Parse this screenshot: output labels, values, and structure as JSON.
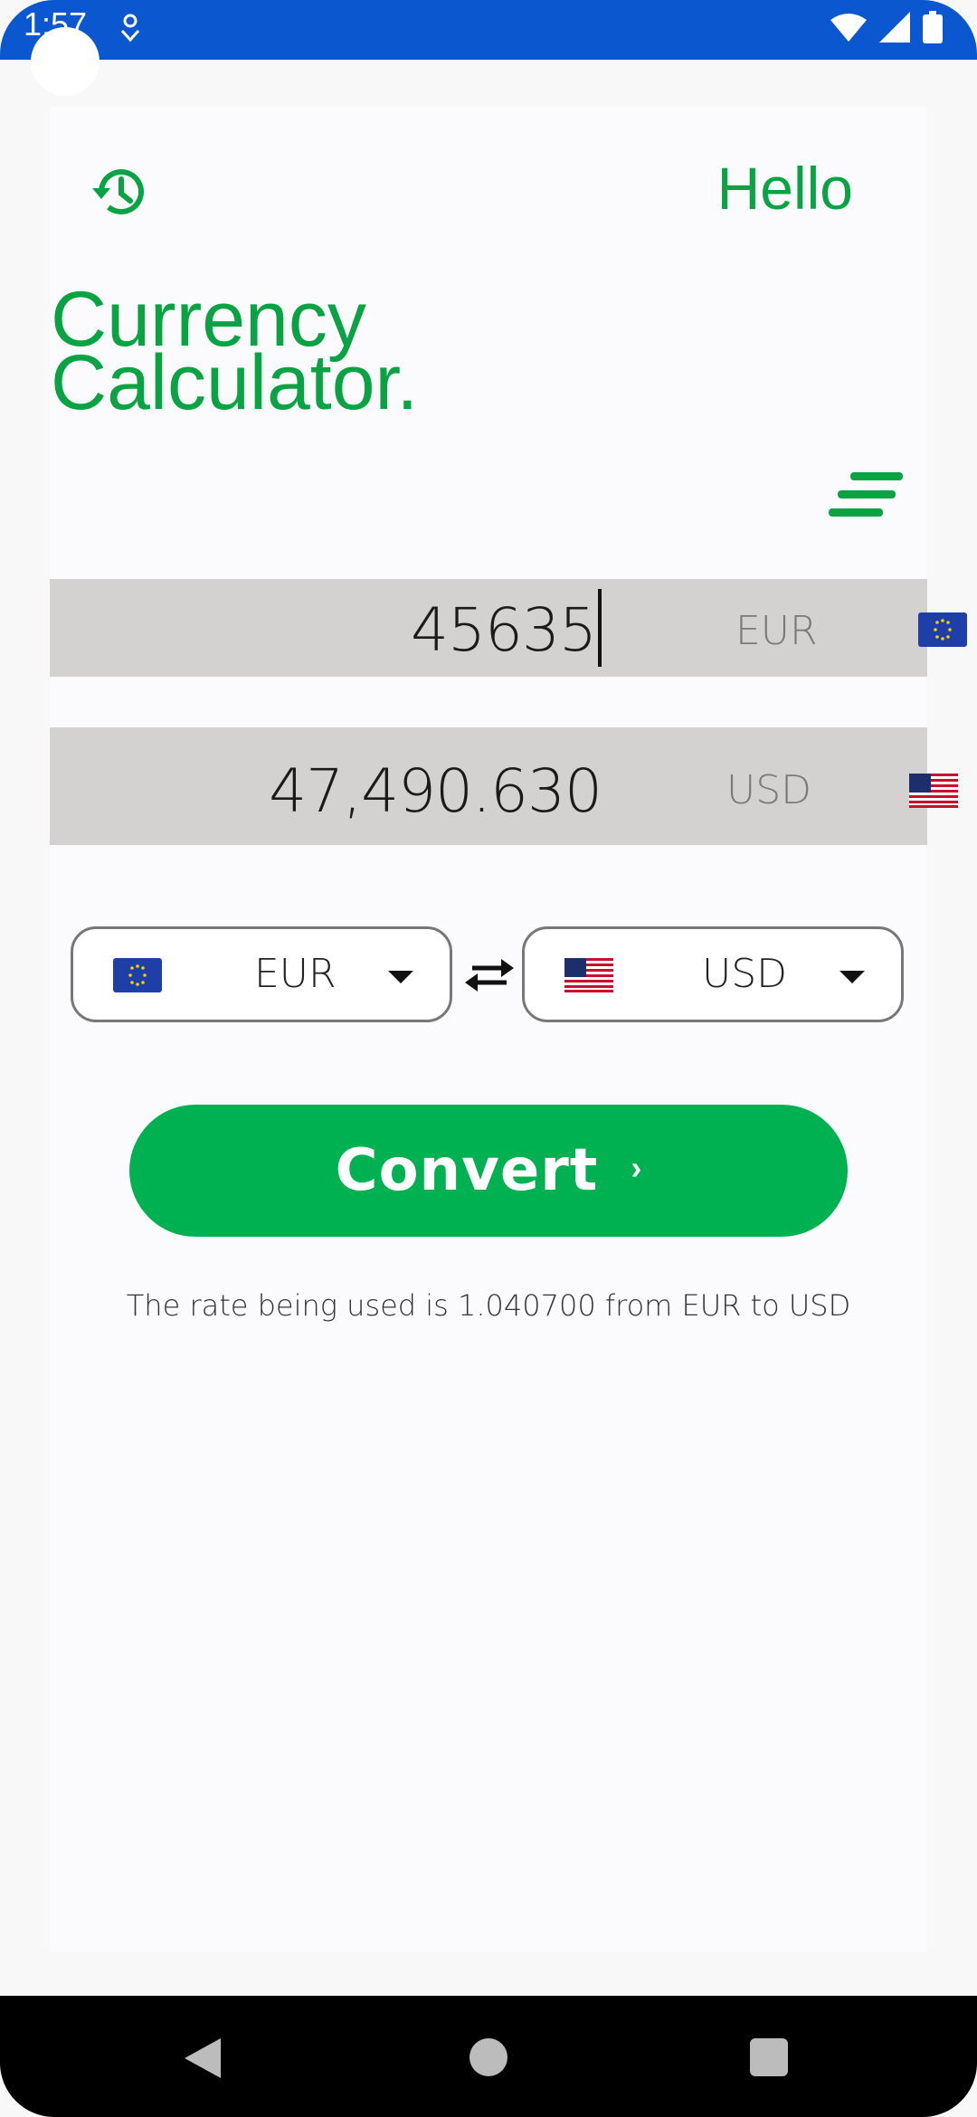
{
  "status_bar": {
    "time": "1:57"
  },
  "header": {
    "greeting": "Hello",
    "title_line1": "Currency",
    "title_line2": "Calculator."
  },
  "from_amount": {
    "value": "45635",
    "currency": "EUR",
    "flag_icon": "eu-flag-icon"
  },
  "to_amount": {
    "value": "47,490.630",
    "currency": "USD",
    "flag_icon": "us-flag-icon"
  },
  "selectors": {
    "from": {
      "currency": "EUR",
      "flag_icon": "eu-flag-icon"
    },
    "to": {
      "currency": "USD",
      "flag_icon": "us-flag-icon"
    }
  },
  "convert_button": {
    "label": "Convert",
    "chevron": "›"
  },
  "rate_text": "The rate being used is 1.040700 from EUR to USD",
  "colors": {
    "brand_green": "#0aa344",
    "button_green": "#00b152",
    "status_bar": "#0b57d0",
    "amount_box": "#d3d2d0"
  }
}
